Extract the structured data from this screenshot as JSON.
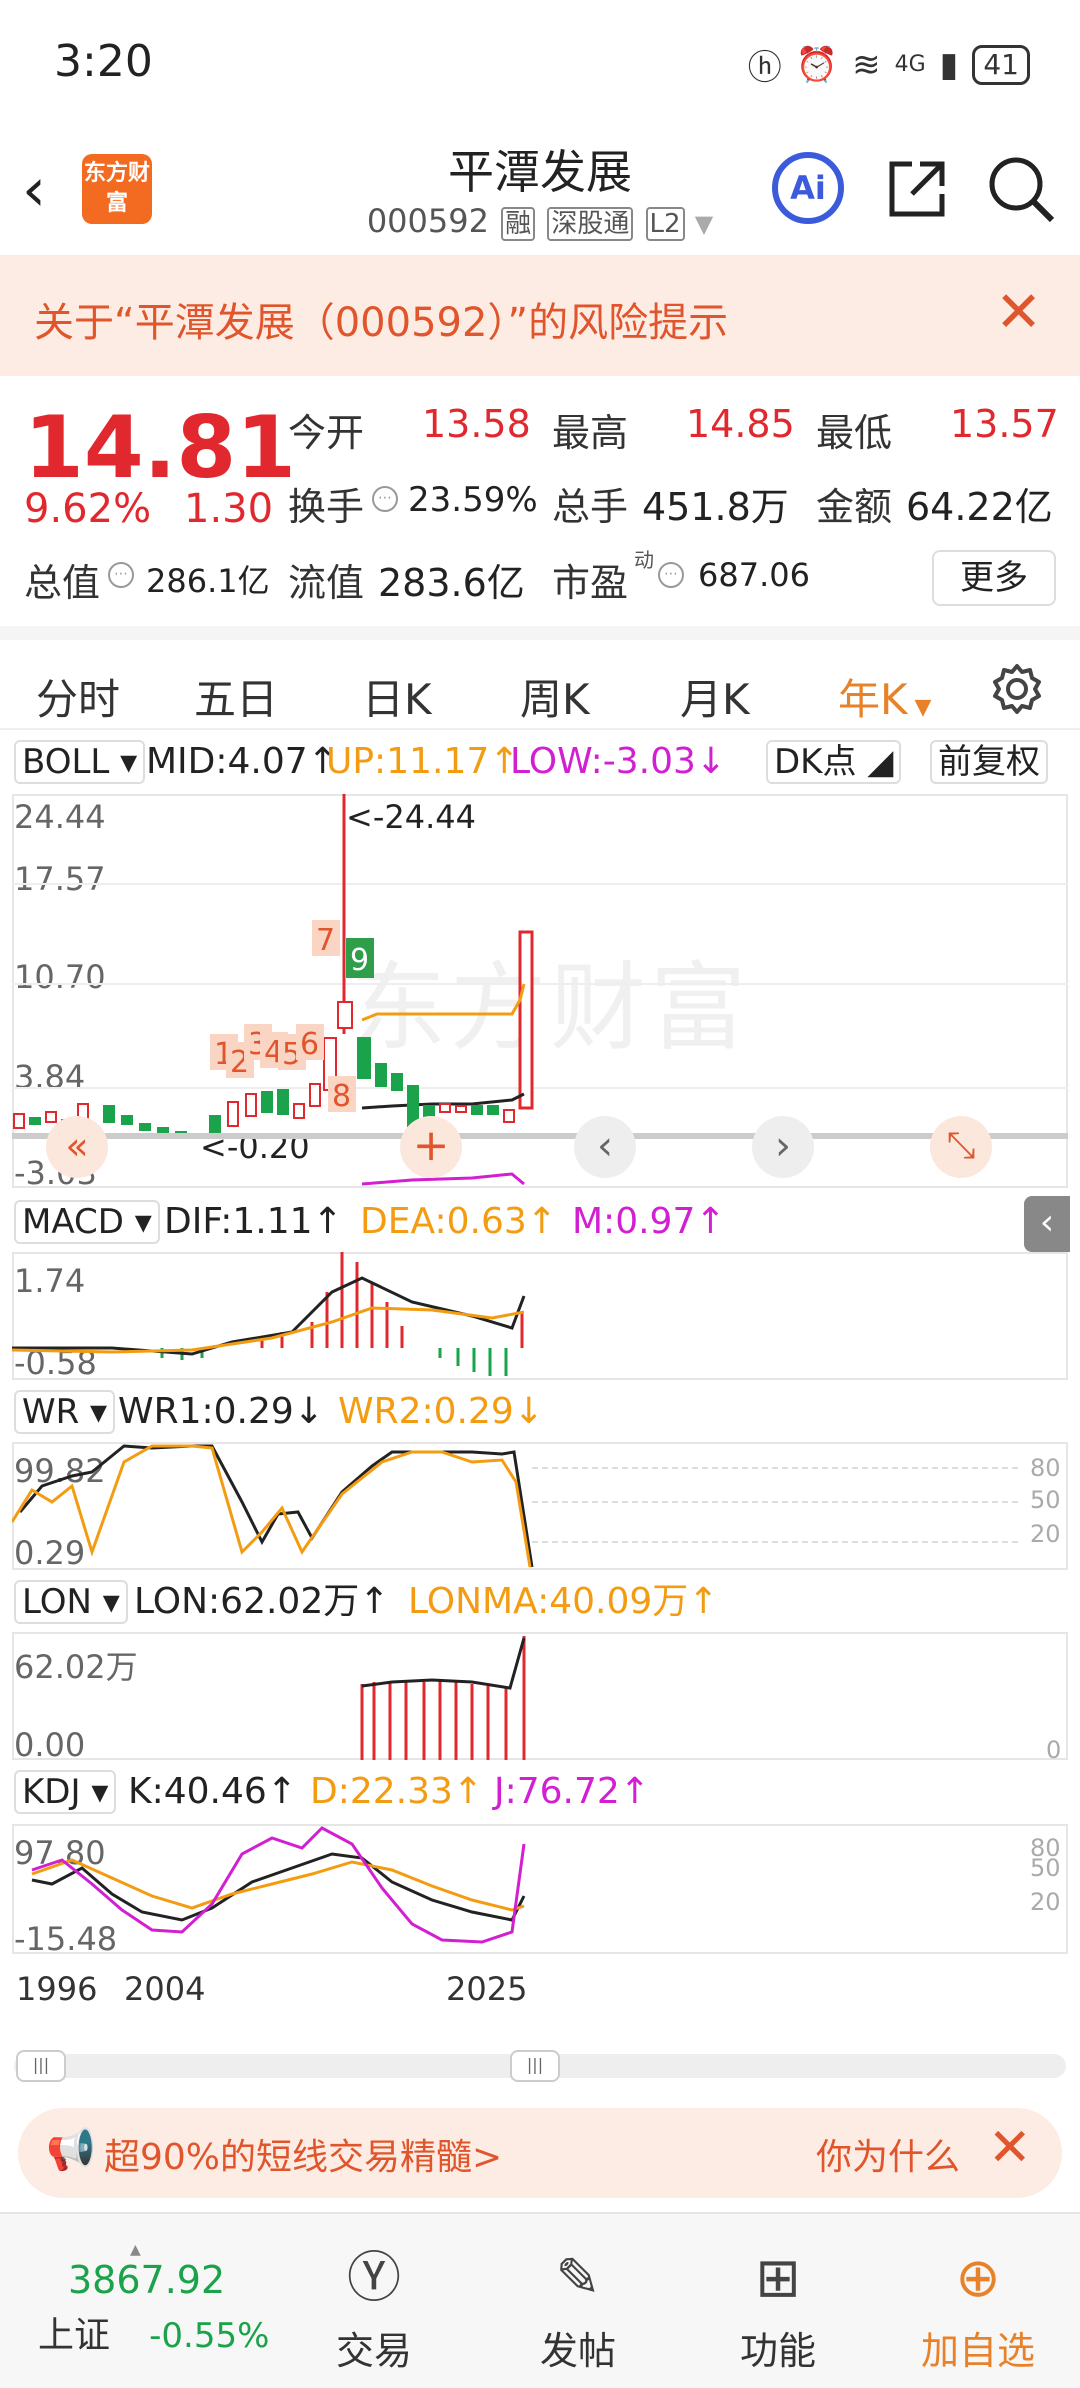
{
  "status": {
    "time": "3:20",
    "network": "4G",
    "battery": "41"
  },
  "header": {
    "back": "‹",
    "logo": "东方财富",
    "title": "平潭发展",
    "code": "000592",
    "tag_rong": "融",
    "tag_sgt": "深股通",
    "tag_l2": "L2",
    "ai": "Ai"
  },
  "risk": {
    "text": "关于“平潭发展（000592）”的风险提示",
    "close": "✕"
  },
  "quote": {
    "price": "14.81",
    "pct": "9.62%",
    "change": "1.30",
    "open_label": "今开",
    "open": "13.58",
    "high_label": "最高",
    "high": "14.85",
    "low_label": "最低",
    "low": "13.57",
    "turnover_label": "换手",
    "turnover": "23.59%",
    "volume_label": "总手",
    "volume": "451.8万",
    "amount_label": "金额",
    "amount": "64.22亿",
    "mcap_label": "总值",
    "mcap": "286.1亿",
    "float_label": "流值",
    "float": "283.6亿",
    "pe_label": "市盈",
    "pe_sup": "动",
    "pe": "687.06",
    "more": "更多"
  },
  "tabs": [
    "分时",
    "五日",
    "日K",
    "周K",
    "月K",
    "年K"
  ],
  "boll": {
    "name": "BOLL",
    "mid": "MID:4.07↑",
    "up": "UP:11.17↑",
    "low": "LOW:-3.03↓",
    "dk": "DK点",
    "adjust": "前复权",
    "axis": [
      "24.44",
      "17.57",
      "10.70",
      "3.84",
      "-3.03"
    ],
    "max_label": "<-24.44",
    "min_label": "<-0.20",
    "markers": [
      "1",
      "2",
      "3",
      "4",
      "5",
      "6",
      "7",
      "8",
      "9"
    ]
  },
  "macd": {
    "name": "MACD",
    "dif": "DIF:1.11↑",
    "dea": "DEA:0.63↑",
    "m": "M:0.97↑",
    "axis": [
      "1.74",
      "-0.58"
    ]
  },
  "wr": {
    "name": "WR",
    "wr1": "WR1:0.29↓",
    "wr2": "WR2:0.29↓",
    "axis": [
      "99.82",
      "0.29"
    ],
    "levels": [
      "80",
      "50",
      "20"
    ]
  },
  "lon": {
    "name": "LON",
    "lon": "LON:62.02万↑",
    "lonma": "LONMA:40.09万↑",
    "axis": [
      "62.02万",
      "0.00"
    ],
    "zero": "0"
  },
  "kdj": {
    "name": "KDJ",
    "k": "K:40.46↑",
    "d": "D:22.33↑",
    "j": "J:76.72↑",
    "axis": [
      "97.80",
      "-15.48"
    ],
    "levels": [
      "80",
      "50",
      "20"
    ]
  },
  "xaxis": [
    "1996",
    "2004",
    "2025"
  ],
  "watermark": "东方财富",
  "promo": {
    "left": "超90%的短线交易精髓>",
    "right": "你为什么"
  },
  "bottom": {
    "index_value": "3867.92",
    "index_name": "上证",
    "index_change": "-0.55%",
    "trade": "交易",
    "post": "发帖",
    "function": "功能",
    "add": "加自选"
  },
  "colors": {
    "up": "#e0282e",
    "down": "#1aa34a",
    "accent": "#e8822a",
    "ma_orange": "#f39c12",
    "magenta": "#d21fd2"
  }
}
